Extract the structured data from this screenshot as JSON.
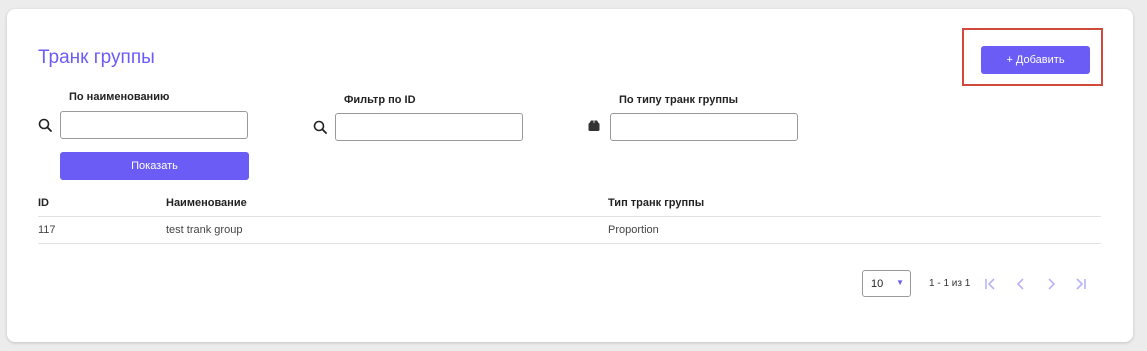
{
  "page": {
    "title": "Транк группы"
  },
  "actions": {
    "add_label": "+ Добавить"
  },
  "filters": {
    "name": {
      "label": "По наименованию",
      "value": "",
      "placeholder": ""
    },
    "id": {
      "label": "Фильтр по ID",
      "value": "",
      "placeholder": ""
    },
    "type": {
      "label": "По типу транк группы",
      "value": "",
      "placeholder": ""
    },
    "show_label": "Показать"
  },
  "table": {
    "headers": {
      "id": "ID",
      "name": "Наименование",
      "type": "Тип транк группы"
    },
    "rows": [
      {
        "id": "117",
        "name": "test trank group",
        "type": "Proportion"
      }
    ]
  },
  "pagination": {
    "per_page": "10",
    "range": "1 - 1 из 1"
  },
  "colors": {
    "accent": "#6b5cf5",
    "highlight": "#d0493a"
  },
  "icons": [
    "search-icon",
    "search-icon",
    "box-icon",
    "first-page-icon",
    "prev-page-icon",
    "next-page-icon",
    "last-page-icon"
  ]
}
